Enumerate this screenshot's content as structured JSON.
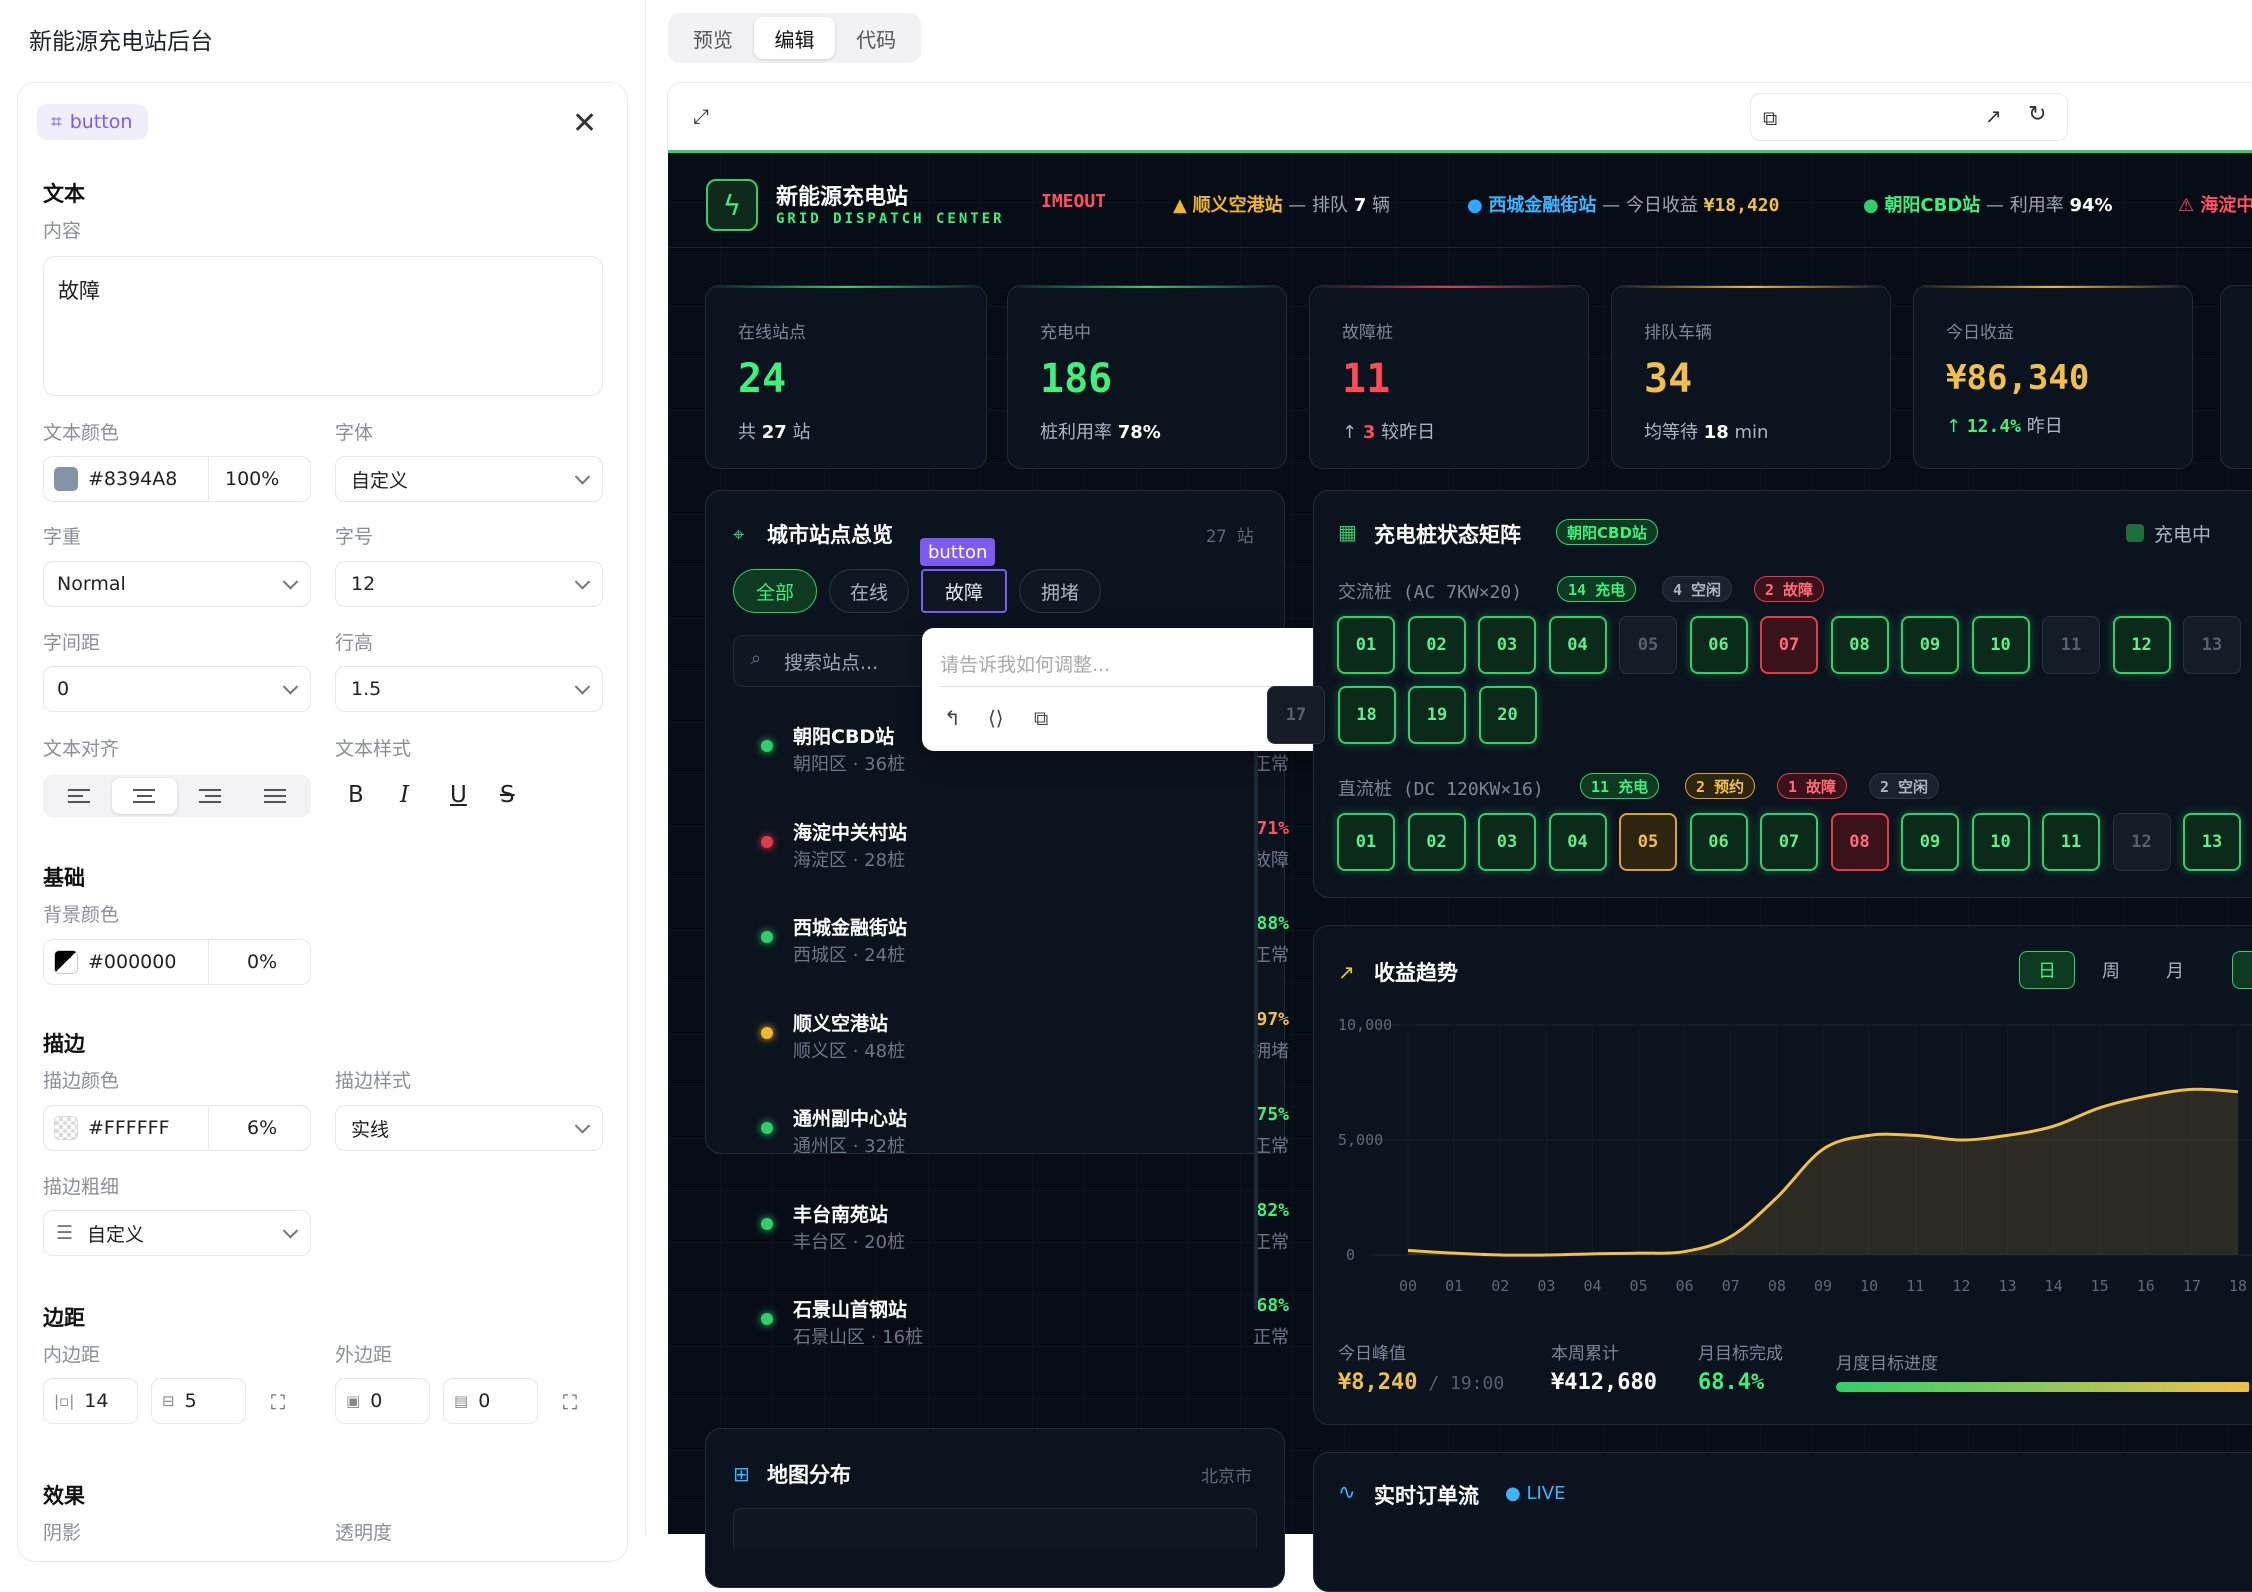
{
  "app": {
    "title": "新能源充电站后台"
  },
  "editor": {
    "chip": "button",
    "sections": {
      "text": "文本",
      "base": "基础",
      "stroke": "描边",
      "spacing": "边距",
      "effect": "效果"
    },
    "labels": {
      "content": "内容",
      "text_color": "文本颜色",
      "font": "字体",
      "weight": "字重",
      "size": "字号",
      "spacing": "字间距",
      "line_height": "行高",
      "align": "文本对齐",
      "style": "文本样式",
      "bg_color": "背景颜色",
      "stroke_color": "描边颜色",
      "stroke_style": "描边样式",
      "stroke_width": "描边粗细",
      "padding": "内边距",
      "margin": "外边距",
      "shadow": "阴影",
      "opacity": "透明度"
    },
    "content": "故障",
    "text_color": {
      "hex": "#8394A8",
      "alpha": "100%"
    },
    "font": "自定义",
    "weight": "Normal",
    "size": "12",
    "letter_spacing": "0",
    "line_height": "1.5",
    "bg_color": {
      "hex": "#000000",
      "alpha": "0%"
    },
    "stroke_color": {
      "hex": "#FFFFFF",
      "alpha": "6%"
    },
    "stroke_style": "实线",
    "stroke_width": "自定义",
    "padding": {
      "x": "14",
      "y": "5"
    },
    "margin": {
      "x": "0",
      "y": "0"
    }
  },
  "view_tabs": [
    "预览",
    "编辑",
    "代码"
  ],
  "dashboard": {
    "brand": "新能源充电站",
    "brand_sub": "GRID DISPATCH CENTER",
    "ticker": {
      "t1": "IMEOUT",
      "t2_name": "顺义空港站",
      "t2_rest": " — 排队 ",
      "t2_num": "7",
      "t2_unit": " 辆",
      "t3_name": "西城金融街站",
      "t3_rest": " — 今日收益 ",
      "t3_num": "¥18,420",
      "t4_name": "朝阳CBD站",
      "t4_rest": " — 利用率 ",
      "t4_num": "94%",
      "t5": "海淀中"
    },
    "kpis": [
      {
        "label": "在线站点",
        "value": "24",
        "sub_a": "共 ",
        "sub_b": "27",
        "sub_c": " 站"
      },
      {
        "label": "充电中",
        "value": "186",
        "sub_a": "桩利用率 ",
        "sub_b": "78%",
        "sub_c": ""
      },
      {
        "label": "故障桩",
        "value": "11",
        "sub_a": "↑ ",
        "sub_b": "3",
        "sub_c": " 较昨日"
      },
      {
        "label": "排队车辆",
        "value": "34",
        "sub_a": "均等待 ",
        "sub_b": "18",
        "sub_c": " min"
      },
      {
        "label": "今日收益",
        "value": "¥86,340",
        "sub_a": "↑ ",
        "sub_b": "12.4%",
        "sub_c": " 昨日"
      }
    ],
    "stations_card": {
      "title": "城市站点总览",
      "count": "27 站",
      "filters": [
        "全部",
        "在线",
        "故障",
        "拥堵"
      ],
      "selected_tag": "button",
      "search_placeholder": "搜索站点..."
    },
    "stations": [
      {
        "name": "朝阳CBD站",
        "desc": "朝阳区 · 36桩",
        "pct": "",
        "status": "正常",
        "color": "#2fd06a"
      },
      {
        "name": "海淀中关村站",
        "desc": "海淀区 · 28桩",
        "pct": "71%",
        "status": "故障",
        "color": "#e33a4a"
      },
      {
        "name": "西城金融街站",
        "desc": "西城区 · 24桩",
        "pct": "88%",
        "status": "正常",
        "color": "#2fd06a"
      },
      {
        "name": "顺义空港站",
        "desc": "顺义区 · 48桩",
        "pct": "97%",
        "status": "拥堵",
        "color": "#f0b72a"
      },
      {
        "name": "通州副中心站",
        "desc": "通州区 · 32桩",
        "pct": "75%",
        "status": "正常",
        "color": "#2fd06a"
      },
      {
        "name": "丰台南苑站",
        "desc": "丰台区 · 20桩",
        "pct": "82%",
        "status": "正常",
        "color": "#2fd06a"
      },
      {
        "name": "石景山首钢站",
        "desc": "石景山区 · 16桩",
        "pct": "68%",
        "status": "正常",
        "color": "#2fd06a"
      }
    ],
    "popup": {
      "placeholder": "请告诉我如何调整..."
    },
    "matrix": {
      "title": "充电桩状态矩阵",
      "station": "朝阳CBD站",
      "legend": "充电中",
      "ac_label": "交流桩 (AC 7KW×20)",
      "ac_badges": [
        "14 充电",
        "4 空闲",
        "2 故障"
      ],
      "ac_row1": [
        {
          "n": "01",
          "s": "c"
        },
        {
          "n": "02",
          "s": "c"
        },
        {
          "n": "03",
          "s": "c"
        },
        {
          "n": "04",
          "s": "c"
        },
        {
          "n": "05",
          "s": "i"
        },
        {
          "n": "06",
          "s": "c"
        },
        {
          "n": "07",
          "s": "f"
        },
        {
          "n": "08",
          "s": "c"
        },
        {
          "n": "09",
          "s": "c"
        },
        {
          "n": "10",
          "s": "c"
        },
        {
          "n": "11",
          "s": "i"
        },
        {
          "n": "12",
          "s": "c"
        },
        {
          "n": "13",
          "s": "i"
        }
      ],
      "ac_row2": [
        {
          "n": "17",
          "s": "i"
        },
        {
          "n": "18",
          "s": "c"
        },
        {
          "n": "19",
          "s": "c"
        },
        {
          "n": "20",
          "s": "c"
        }
      ],
      "dc_label": "直流桩 (DC 120KW×16)",
      "dc_badges": [
        "11 充电",
        "2 预约",
        "1 故障",
        "2 空闲"
      ],
      "dc_row": [
        {
          "n": "01",
          "s": "c"
        },
        {
          "n": "02",
          "s": "c"
        },
        {
          "n": "03",
          "s": "c"
        },
        {
          "n": "04",
          "s": "c"
        },
        {
          "n": "05",
          "s": "r"
        },
        {
          "n": "06",
          "s": "c"
        },
        {
          "n": "07",
          "s": "c"
        },
        {
          "n": "08",
          "s": "f"
        },
        {
          "n": "09",
          "s": "c"
        },
        {
          "n": "10",
          "s": "c"
        },
        {
          "n": "11",
          "s": "c"
        },
        {
          "n": "12",
          "s": "i"
        },
        {
          "n": "13",
          "s": "c"
        }
      ]
    },
    "revenue": {
      "title": "收益趋势",
      "periods": [
        "日",
        "周",
        "月"
      ],
      "summary": {
        "peak_label": "今日峰值",
        "peak": "¥8,240",
        "peak_time": "19:00",
        "week_label": "本周累计",
        "week": "¥412,680",
        "goal_label": "月目标完成",
        "goal": "68.4%",
        "progress_label": "月度目标进度"
      }
    },
    "map": {
      "title": "地图分布",
      "city": "北京市"
    },
    "orders": {
      "title": "实时订单流",
      "live": "LIVE"
    }
  },
  "chart_data": {
    "type": "area",
    "title": "收益趋势",
    "x": [
      "00",
      "01",
      "02",
      "03",
      "04",
      "05",
      "06",
      "07",
      "08",
      "09",
      "10",
      "11",
      "12",
      "13",
      "14",
      "15",
      "16",
      "17",
      "18"
    ],
    "values": [
      200,
      80,
      0,
      0,
      50,
      80,
      150,
      800,
      2500,
      4600,
      5200,
      5200,
      5000,
      5200,
      5600,
      6400,
      6900,
      7200,
      7100
    ],
    "yticks": [
      "10,000",
      "5,000",
      "0"
    ],
    "ylim": [
      0,
      10000
    ],
    "grid": true,
    "goal_progress": 0.684,
    "series_color": "#f0c049"
  }
}
